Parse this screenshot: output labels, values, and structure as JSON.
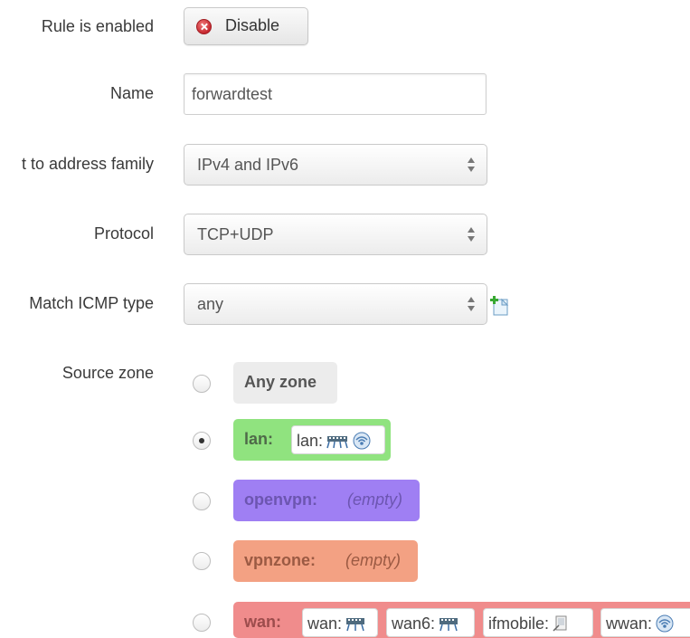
{
  "form": {
    "enabled": {
      "label": "Rule is enabled",
      "button_label": "Disable",
      "button_icon": "disable-x-icon"
    },
    "name": {
      "label": "Name",
      "value": "forwardtest"
    },
    "family": {
      "label": "t to address family",
      "value": "IPv4 and IPv6"
    },
    "protocol": {
      "label": "Protocol",
      "value": "TCP+UDP"
    },
    "icmp": {
      "label": "Match ICMP type",
      "value": "any",
      "add_icon": "add-item-icon"
    },
    "source_zone": {
      "label": "Source zone",
      "options": [
        {
          "name": "Any zone",
          "checked": false,
          "color": "#ececec"
        },
        {
          "name": "lan:",
          "checked": true,
          "color": "#90e37f",
          "members": [
            {
              "label": "lan:",
              "icons": [
                "network-switch-icon",
                "wifi-icon"
              ]
            }
          ]
        },
        {
          "name": "openvpn:",
          "checked": false,
          "color": "#9f7ff3",
          "empty_text": "(empty)"
        },
        {
          "name": "vpnzone:",
          "checked": false,
          "color": "#f3a183",
          "empty_text": "(empty)"
        },
        {
          "name": "wan:",
          "checked": false,
          "color": "#f08c8c",
          "members": [
            {
              "label": "wan:",
              "icons": [
                "ethernet-port-icon"
              ]
            },
            {
              "label": "wan6:",
              "icons": [
                "ethernet-port-icon"
              ]
            },
            {
              "label": "ifmobile:",
              "icons": [
                "device-icon"
              ]
            },
            {
              "label": "wwan:",
              "icons": [
                "wifi-icon"
              ]
            }
          ]
        }
      ]
    }
  }
}
